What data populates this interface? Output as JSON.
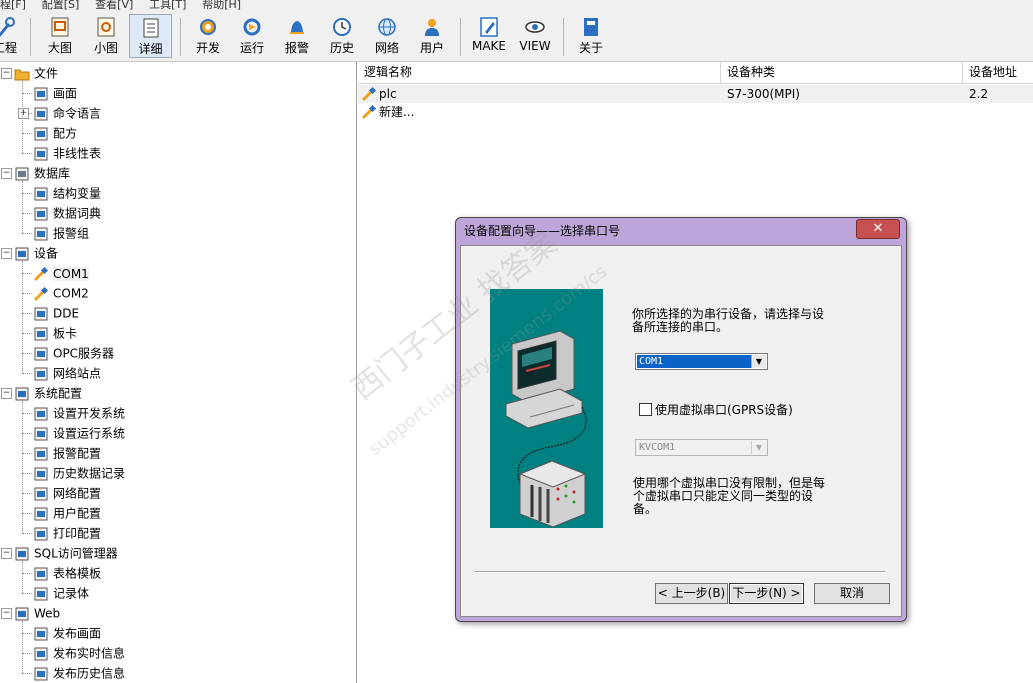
{
  "menubar": [
    "程[F]",
    "配置[S]",
    "查看[V]",
    "工具[T]",
    "帮助[H]"
  ],
  "toolbar": {
    "items": [
      {
        "label": "工程",
        "icon": "tools-icon"
      },
      {
        "label": "大图",
        "icon": "large-icons-icon"
      },
      {
        "label": "小图",
        "icon": "small-icons-icon"
      },
      {
        "label": "详细",
        "icon": "details-icon",
        "active": true
      },
      {
        "label": "开发",
        "icon": "develop-gear-icon"
      },
      {
        "label": "运行",
        "icon": "run-icon"
      },
      {
        "label": "报警",
        "icon": "alarm-bell-icon"
      },
      {
        "label": "历史",
        "icon": "history-clock-icon"
      },
      {
        "label": "网络",
        "icon": "network-globe-icon"
      },
      {
        "label": "用户",
        "icon": "user-icon"
      },
      {
        "label": "MAKE",
        "icon": "make-pencil-icon"
      },
      {
        "label": "VIEW",
        "icon": "view-eye-icon"
      },
      {
        "label": "关于",
        "icon": "about-book-icon"
      }
    ]
  },
  "tree": {
    "items": [
      {
        "label": "文件",
        "icon": "folder-icon",
        "level": 0,
        "expanded": true
      },
      {
        "label": "画面",
        "icon": "screen-icon",
        "level": 1
      },
      {
        "label": "命令语言",
        "icon": "command-icon",
        "level": 1,
        "collapsed": true
      },
      {
        "label": "配方",
        "icon": "recipe-icon",
        "level": 1
      },
      {
        "label": "非线性表",
        "icon": "nonlinear-table-icon",
        "level": 1
      },
      {
        "label": "数据库",
        "icon": "database-icon",
        "level": 0,
        "expanded": true
      },
      {
        "label": "结构变量",
        "icon": "struct-variable-icon",
        "level": 1
      },
      {
        "label": "数据词典",
        "icon": "data-dictionary-icon",
        "level": 1
      },
      {
        "label": "报警组",
        "icon": "alarm-group-icon",
        "level": 1
      },
      {
        "label": "设备",
        "icon": "device-icon",
        "level": 0,
        "expanded": true
      },
      {
        "label": "COM1",
        "icon": "serial-port-icon",
        "level": 1,
        "selected": true
      },
      {
        "label": "COM2",
        "icon": "serial-port-icon",
        "level": 1
      },
      {
        "label": "DDE",
        "icon": "dde-icon",
        "level": 1
      },
      {
        "label": "板卡",
        "icon": "board-card-icon",
        "level": 1
      },
      {
        "label": "OPC服务器",
        "icon": "opc-server-icon",
        "level": 1
      },
      {
        "label": "网络站点",
        "icon": "network-station-icon",
        "level": 1
      },
      {
        "label": "系统配置",
        "icon": "system-config-icon",
        "level": 0,
        "expanded": true
      },
      {
        "label": "设置开发系统",
        "icon": "dev-system-icon",
        "level": 1
      },
      {
        "label": "设置运行系统",
        "icon": "run-system-icon",
        "level": 1
      },
      {
        "label": "报警配置",
        "icon": "alarm-config-icon",
        "level": 1
      },
      {
        "label": "历史数据记录",
        "icon": "history-record-icon",
        "level": 1
      },
      {
        "label": "网络配置",
        "icon": "network-config-icon",
        "level": 1
      },
      {
        "label": "用户配置",
        "icon": "user-config-icon",
        "level": 1
      },
      {
        "label": "打印配置",
        "icon": "print-config-icon",
        "level": 1
      },
      {
        "label": "SQL访问管理器",
        "icon": "sql-manager-icon",
        "level": 0,
        "expanded": true
      },
      {
        "label": "表格模板",
        "icon": "table-template-icon",
        "level": 1
      },
      {
        "label": "记录体",
        "icon": "record-icon",
        "level": 1
      },
      {
        "label": "Web",
        "icon": "web-icon",
        "level": 0,
        "expanded": true
      },
      {
        "label": "发布画面",
        "icon": "publish-screen-icon",
        "level": 1
      },
      {
        "label": "发布实时信息",
        "icon": "publish-realtime-icon",
        "level": 1
      },
      {
        "label": "发布历史信息",
        "icon": "publish-history-icon",
        "level": 1
      }
    ]
  },
  "list": {
    "columns": [
      "逻辑名称",
      "设备种类",
      "设备地址"
    ],
    "rows": [
      {
        "name": "plc",
        "type": "S7-300(MPI)",
        "address": "2.2"
      },
      {
        "name": "新建...",
        "type": "",
        "address": ""
      }
    ]
  },
  "dialog": {
    "title": "设备配置向导——选择串口号",
    "close": "✕",
    "description": "你所选择的为串行设备，请选择与设备所连接的串口。",
    "com_value": "COM1",
    "virtual_com_label": "使用虚拟串口(GPRS设备)",
    "virtual_com_checked": false,
    "kvcom_value": "KVCOM1",
    "note": "使用哪个虚拟串口没有限制，但是每个虚拟串口只能定义同一类型的设备。",
    "prev_button": "< 上一步(B)",
    "next_button": "下一步(N) >",
    "cancel_button": "取消"
  },
  "watermark": {
    "line1": "西门子工业  找答案",
    "line2": "support.industry.siemens.com/cs"
  },
  "colors": {
    "dialog_frame": "#bda5d9",
    "illustration_bg": "#008080",
    "selection_blue": "#0a64c8"
  }
}
